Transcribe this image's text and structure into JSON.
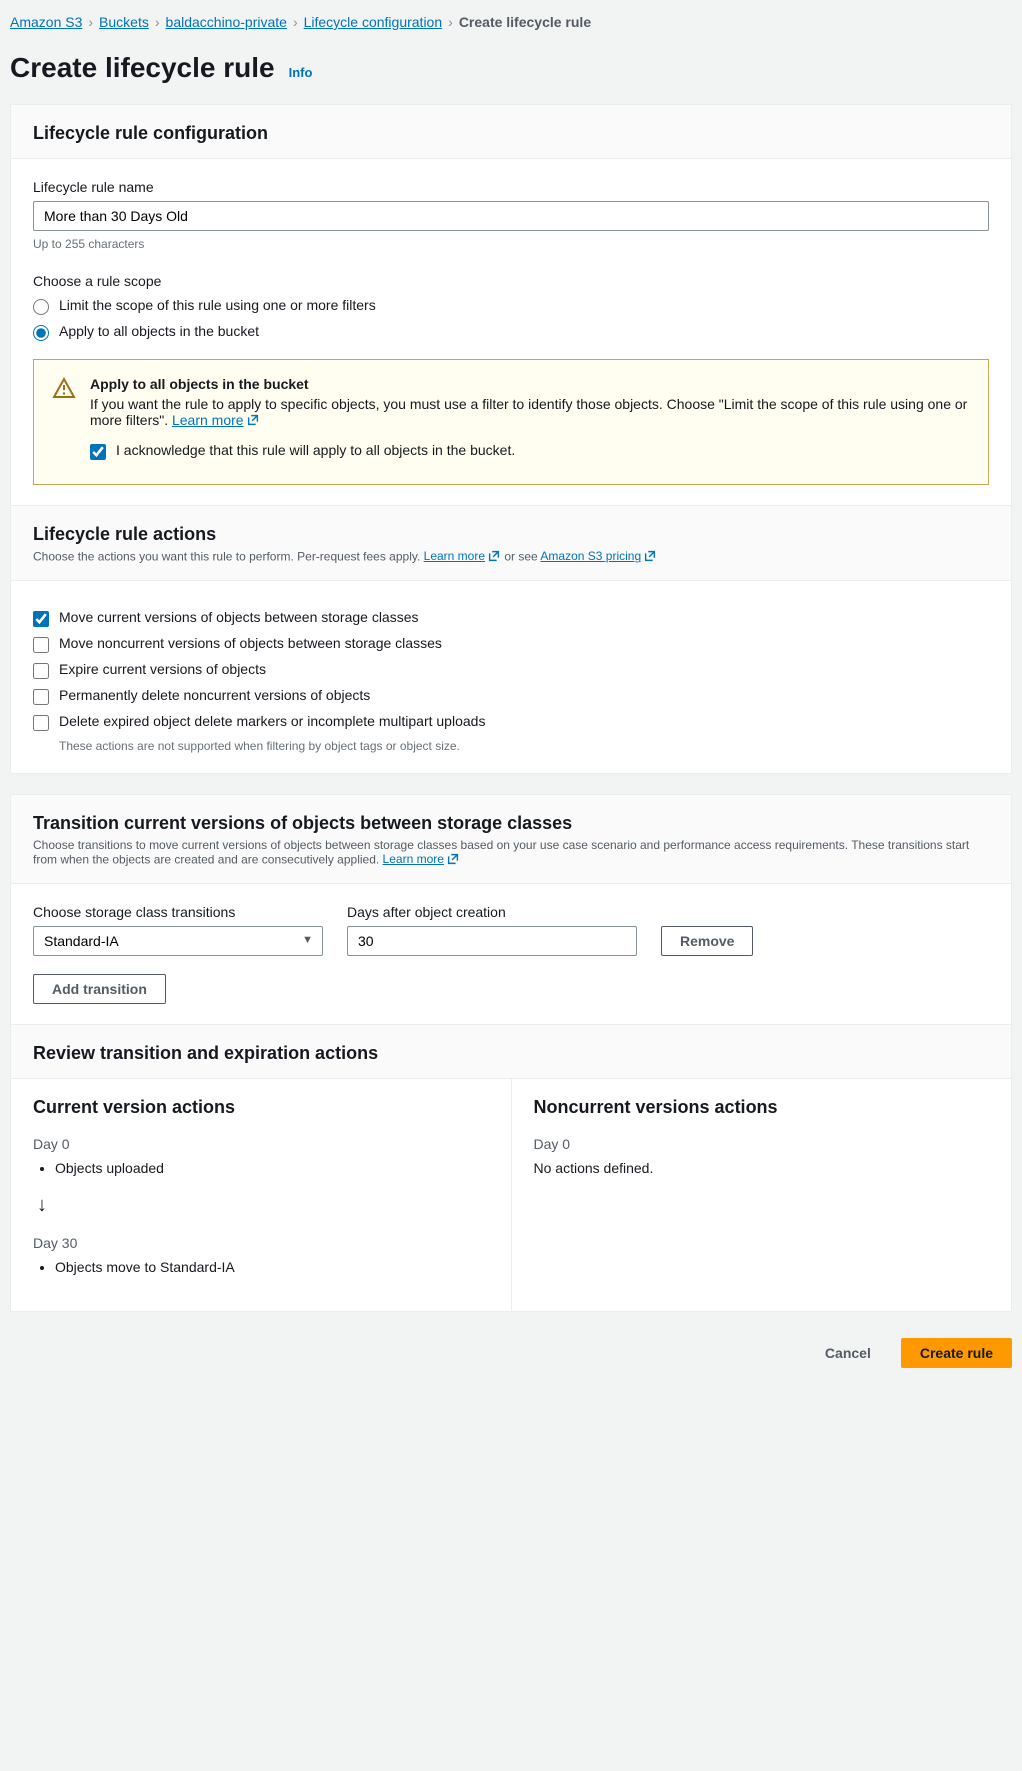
{
  "breadcrumb": [
    {
      "label": "Amazon S3",
      "current": false
    },
    {
      "label": "Buckets",
      "current": false
    },
    {
      "label": "baldacchino-private",
      "current": false
    },
    {
      "label": "Lifecycle configuration",
      "current": false
    },
    {
      "label": "Create lifecycle rule",
      "current": true
    }
  ],
  "page": {
    "title": "Create lifecycle rule",
    "info": "Info"
  },
  "config": {
    "heading": "Lifecycle rule configuration",
    "name_label": "Lifecycle rule name",
    "name_value": "More than 30 Days Old",
    "name_hint": "Up to 255 characters",
    "scope_label": "Choose a rule scope",
    "scope_options": {
      "limit": "Limit the scope of this rule using one or more filters",
      "all": "Apply to all objects in the bucket"
    },
    "scope_selected": "all",
    "alert": {
      "title": "Apply to all objects in the bucket",
      "text": "If you want the rule to apply to specific objects, you must use a filter to identify those objects. Choose \"Limit the scope of this rule using one or more filters\".",
      "learn_more": "Learn more",
      "ack_label": "I acknowledge that this rule will apply to all objects in the bucket.",
      "ack_checked": true
    }
  },
  "actions": {
    "heading": "Lifecycle rule actions",
    "desc_prefix": "Choose the actions you want this rule to perform. Per-request fees apply.",
    "learn_more": "Learn more",
    "or_see": "or see",
    "pricing": "Amazon S3 pricing",
    "items": [
      {
        "label": "Move current versions of objects between storage classes",
        "checked": true
      },
      {
        "label": "Move noncurrent versions of objects between storage classes",
        "checked": false
      },
      {
        "label": "Expire current versions of objects",
        "checked": false
      },
      {
        "label": "Permanently delete noncurrent versions of objects",
        "checked": false
      },
      {
        "label": "Delete expired object delete markers or incomplete multipart uploads",
        "checked": false
      }
    ],
    "disabled_note": "These actions are not supported when filtering by object tags or object size."
  },
  "transitions": {
    "heading": "Transition current versions of objects between storage classes",
    "desc": "Choose transitions to move current versions of objects between storage classes based on your use case scenario and performance access requirements. These transitions start from when the objects are created and are consecutively applied.",
    "learn_more": "Learn more",
    "storage_label": "Choose storage class transitions",
    "storage_value": "Standard-IA",
    "days_label": "Days after object creation",
    "days_value": "30",
    "remove": "Remove",
    "add": "Add transition"
  },
  "review": {
    "heading": "Review transition and expiration actions",
    "current": {
      "title": "Current version actions",
      "steps": [
        {
          "day": "Day 0",
          "items": [
            "Objects uploaded"
          ]
        },
        {
          "day": "Day 30",
          "items": [
            "Objects move to Standard-IA"
          ]
        }
      ]
    },
    "noncurrent": {
      "title": "Noncurrent versions actions",
      "day0": "Day 0",
      "none": "No actions defined."
    }
  },
  "footer": {
    "cancel": "Cancel",
    "create": "Create rule"
  }
}
